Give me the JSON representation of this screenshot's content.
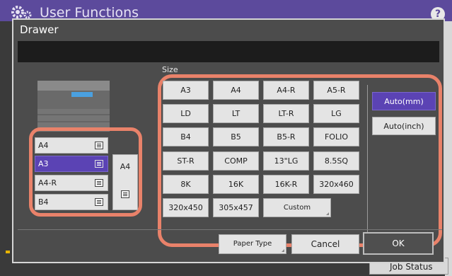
{
  "app": {
    "title": "User Functions",
    "help": "?",
    "job_status": "Job Status"
  },
  "dialog": {
    "title": "Drawer",
    "size_label": "Size",
    "trays": [
      {
        "label": "A4"
      },
      {
        "label": "A3"
      },
      {
        "label": "A4-R"
      },
      {
        "label": "B4"
      }
    ],
    "tray_side_label": "A4",
    "sizes": [
      [
        "A3",
        "A4",
        "A4-R",
        "A5-R"
      ],
      [
        "LD",
        "LT",
        "LT-R",
        "LG"
      ],
      [
        "B4",
        "B5",
        "B5-R",
        "FOLIO"
      ],
      [
        "ST-R",
        "COMP",
        "13\"LG",
        "8.5SQ"
      ],
      [
        "8K",
        "16K",
        "16K-R",
        "320x460"
      ],
      [
        "320x450",
        "305x457",
        "Custom"
      ]
    ],
    "auto_mm": "Auto(mm)",
    "auto_inch": "Auto(inch)",
    "paper_type": "Paper Type",
    "cancel": "Cancel",
    "ok": "OK"
  }
}
